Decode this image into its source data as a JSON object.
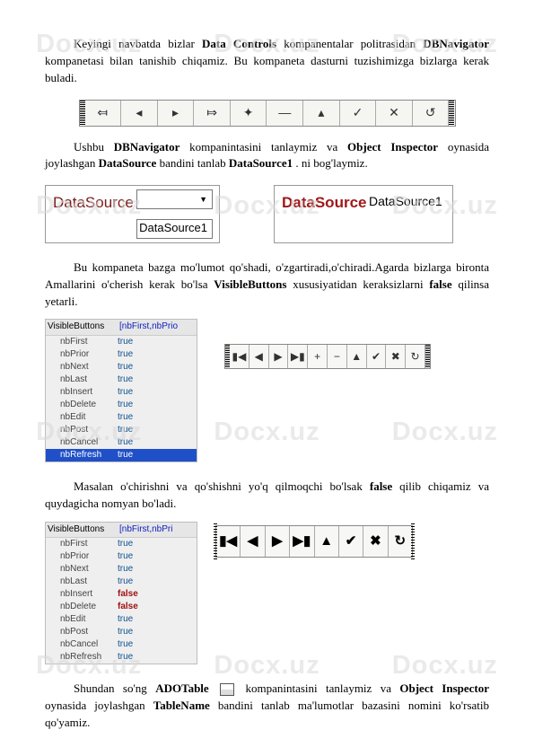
{
  "watermark": "Docx.uz",
  "paragraphs": {
    "p1_a": "Keyingi navbatda bizlar ",
    "p1_b": "Data Controls",
    "p1_c": " kompanentalar politrasidan ",
    "p1_d": "DBNavigator",
    "p1_e": " kompanetasi bilan tanishib chiqamiz. Bu kompaneta dasturni tuzishimizga bizlarga kerak buladi.",
    "p2_a": "Ushbu ",
    "p2_b": "DBNavigator",
    "p2_c": " kompanintasini tanlaymiz va ",
    "p2_d": "Object Inspector",
    "p2_e": " oynasida joylashgan ",
    "p2_f": "DataSource",
    "p2_g": " bandini tanlab ",
    "p2_h": "DataSource1",
    "p2_i": ". ni bog'laymiz.",
    "p3_a": "Bu kompaneta bazga mo'lumot qo'shadi, o'zgartiradi,o'chiradi.Agarda bizlarga bironta Amallarini o'cherish kerak bo'lsa ",
    "p3_b": "VisibleButtons",
    "p3_c": " xususiyatidan keraksizlarni ",
    "p3_d": "false",
    "p3_e": " qilinsa yetarli.",
    "p4_a": "Masalan o'chirishni va qo'shishni yo'q qilmoqchi bo'lsak ",
    "p4_b": "false",
    "p4_c": " qilib chiqamiz va quydagicha nomyan bo'ladi.",
    "p5_a": "Shundan so'ng ",
    "p5_b": "ADOTable",
    "p5_c": " kompanintasini tanlaymiz va ",
    "p5_d": "Object Inspector",
    "p5_e": " oynasida joylashgan ",
    "p5_f": "TableName",
    "p5_g": " bandini tanlab ma'lumotlar bazasini nomini ko'rsatib qo'yamiz."
  },
  "nav_icons": {
    "first": "⤆",
    "prior": "◂",
    "next": "▸",
    "last": "⤇",
    "insert": "✦",
    "delete": "—",
    "edit": "▴",
    "post": "✓",
    "cancel": "✕",
    "refresh": "↺"
  },
  "nav_icons_bold": {
    "first": "▮◀",
    "prior": "◀",
    "next": "▶",
    "last": "▶▮",
    "edit": "▲",
    "post": "✔",
    "cancel": "✖",
    "refresh": "↻"
  },
  "datasource": {
    "label": "DataSource",
    "value": "DataSource1"
  },
  "visible_buttons_1": {
    "header_key": "VisibleButtons",
    "header_val": "[nbFirst,nbPrio",
    "rows": [
      {
        "k": "nbFirst",
        "v": "true"
      },
      {
        "k": "nbPrior",
        "v": "true"
      },
      {
        "k": "nbNext",
        "v": "true"
      },
      {
        "k": "nbLast",
        "v": "true"
      },
      {
        "k": "nbInsert",
        "v": "true"
      },
      {
        "k": "nbDelete",
        "v": "true"
      },
      {
        "k": "nbEdit",
        "v": "true"
      },
      {
        "k": "nbPost",
        "v": "true"
      },
      {
        "k": "nbCancel",
        "v": "true"
      },
      {
        "k": "nbRefresh",
        "v": "true",
        "selected": true
      }
    ]
  },
  "visible_buttons_2": {
    "header_key": "VisibleButtons",
    "header_val": "[nbFirst,nbPri",
    "rows": [
      {
        "k": "nbFirst",
        "v": "true"
      },
      {
        "k": "nbPrior",
        "v": "true"
      },
      {
        "k": "nbNext",
        "v": "true"
      },
      {
        "k": "nbLast",
        "v": "true"
      },
      {
        "k": "nbInsert",
        "v": "false",
        "false": true
      },
      {
        "k": "nbDelete",
        "v": "false",
        "false": true
      },
      {
        "k": "nbEdit",
        "v": "true"
      },
      {
        "k": "nbPost",
        "v": "true"
      },
      {
        "k": "nbCancel",
        "v": "true"
      },
      {
        "k": "nbRefresh",
        "v": "true"
      }
    ]
  }
}
